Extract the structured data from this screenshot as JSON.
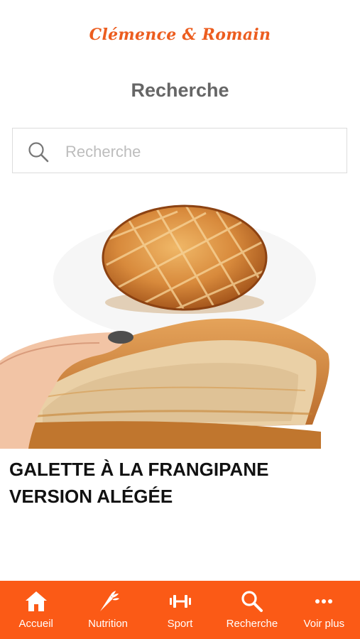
{
  "header": {
    "brand": "Clémence & Romain",
    "title": "Recherche"
  },
  "search": {
    "placeholder": "Recherche",
    "value": "",
    "icon": "search-icon"
  },
  "recipe_card": {
    "title": "GALETTE À LA FRANGIPANE VERSION ALÉGÉE"
  },
  "tabbar": {
    "accent_color": "#fb5a16",
    "items": [
      {
        "label": "Accueil",
        "icon": "home-icon"
      },
      {
        "label": "Nutrition",
        "icon": "carrot-icon"
      },
      {
        "label": "Sport",
        "icon": "dumbbell-icon"
      },
      {
        "label": "Recherche",
        "icon": "search-icon"
      },
      {
        "label": "Voir plus",
        "icon": "more-icon"
      }
    ]
  }
}
